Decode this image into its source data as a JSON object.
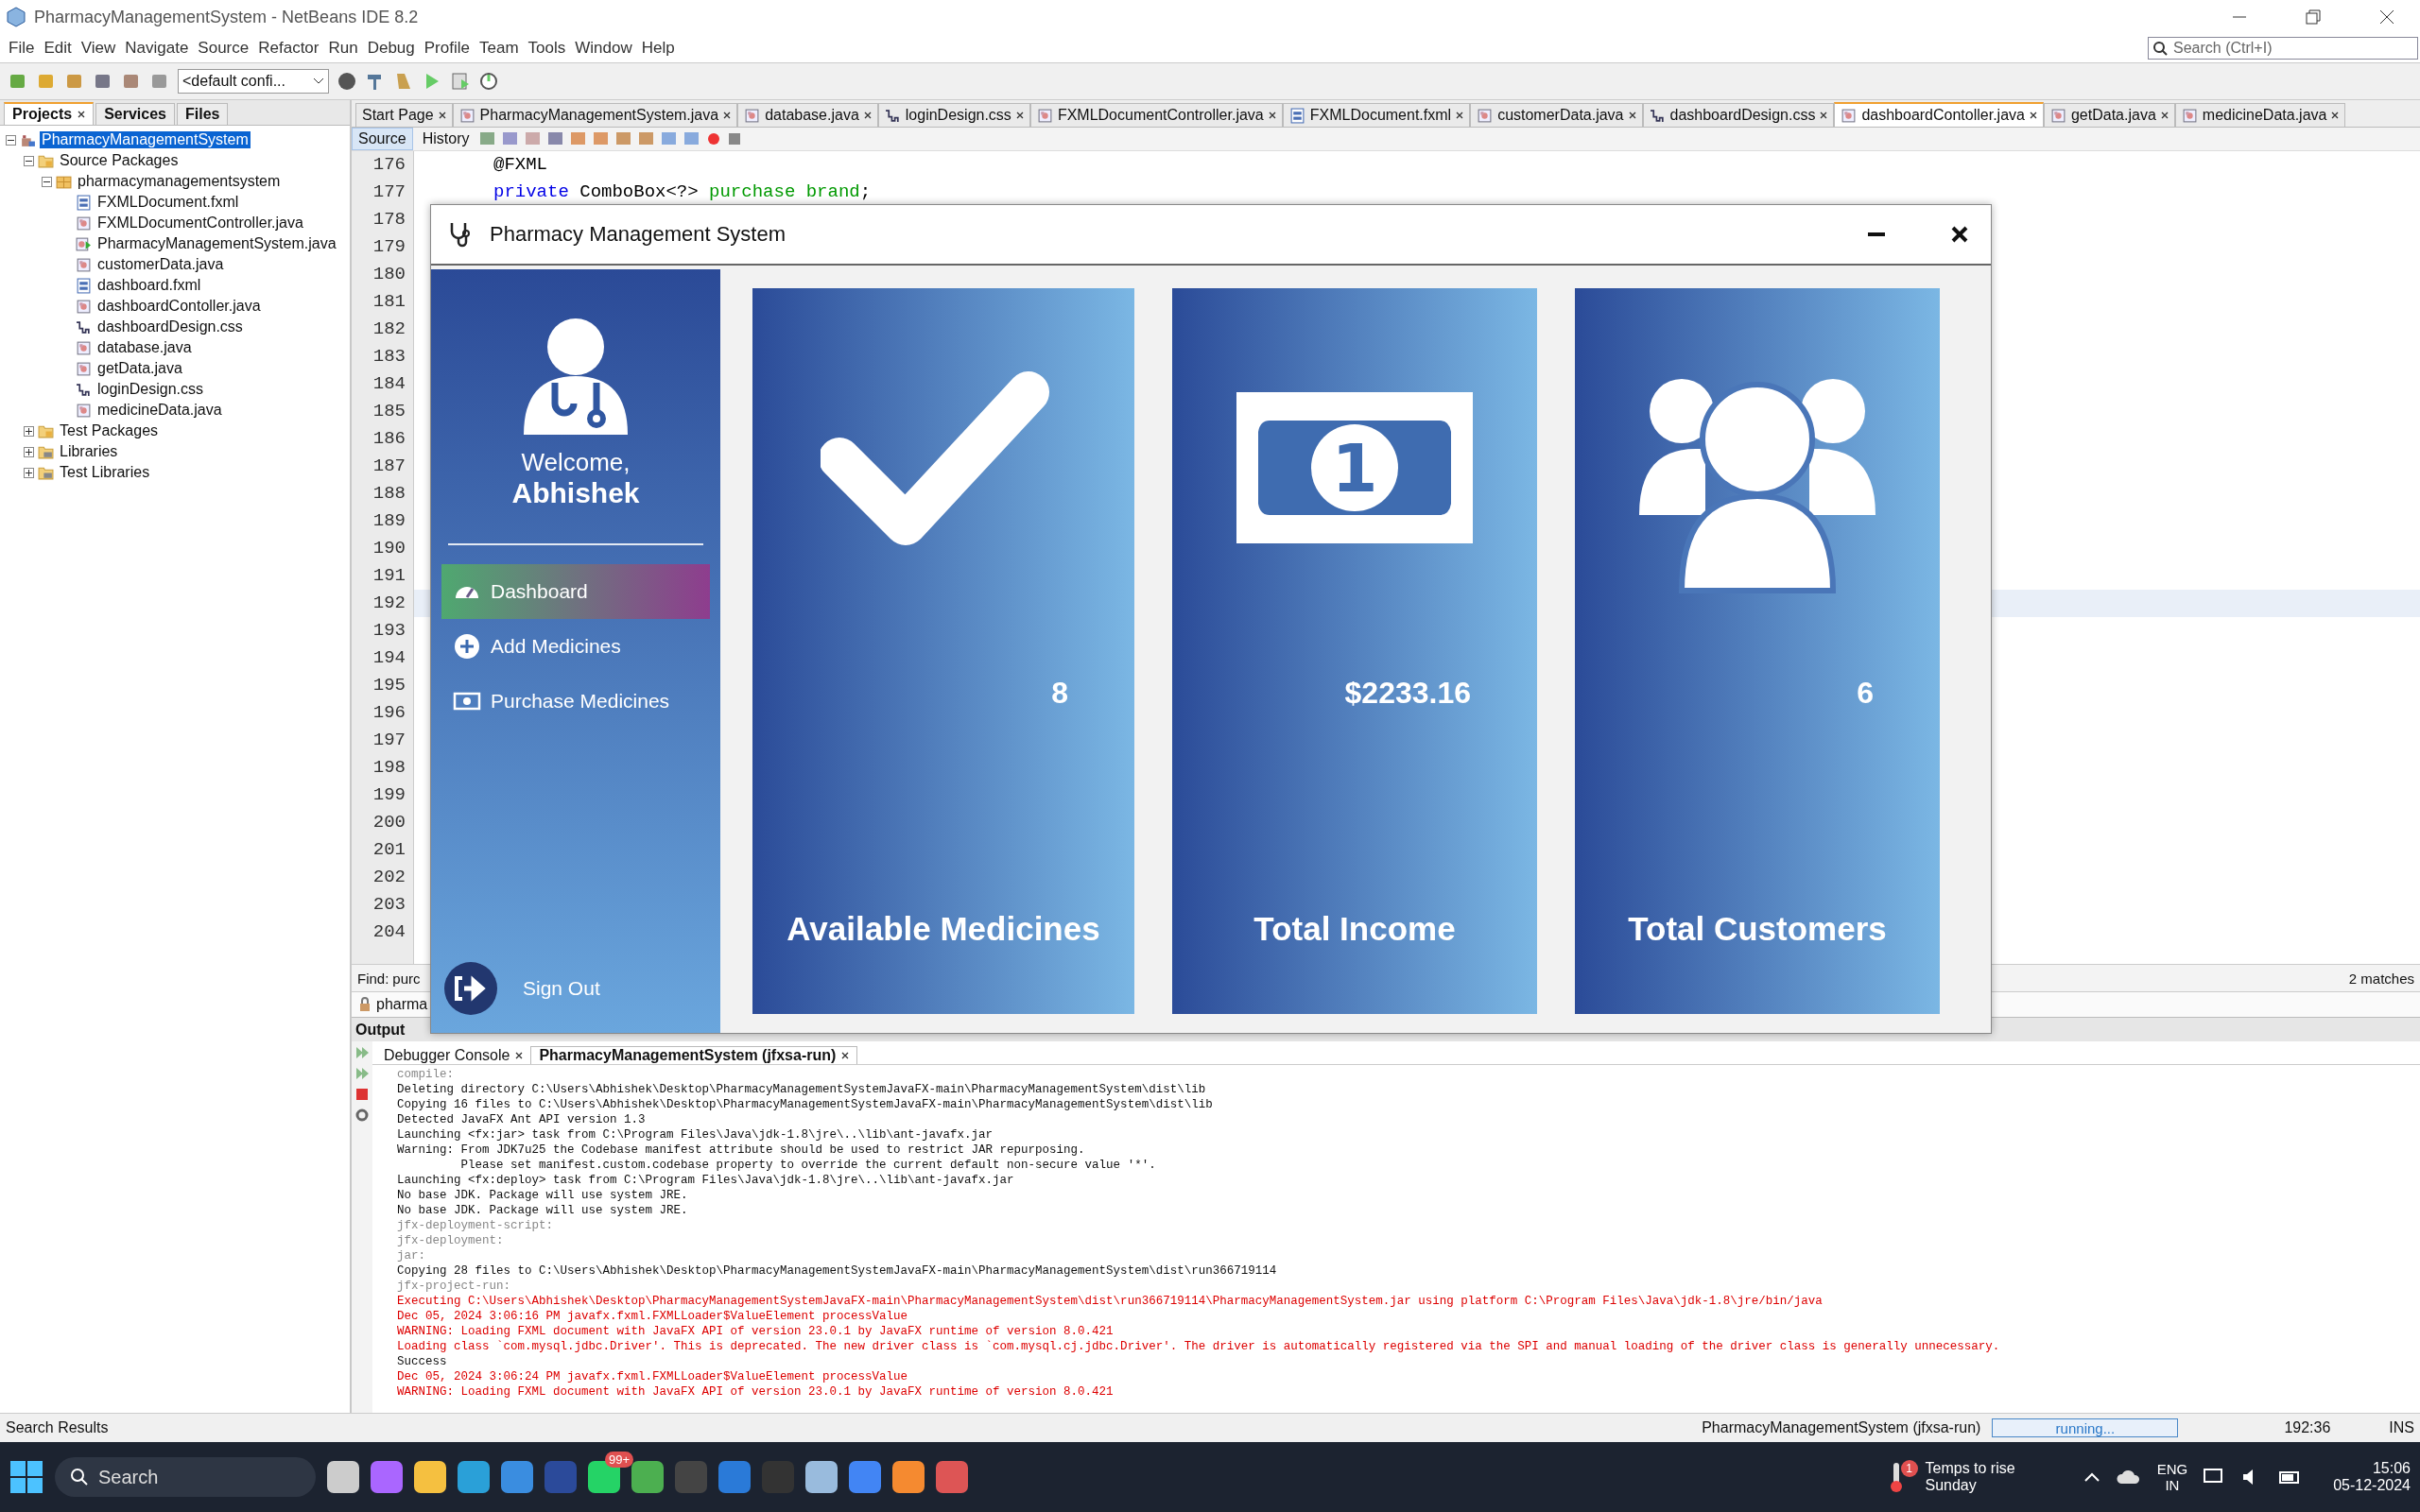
{
  "window": {
    "title": "PharmacyManagementSystem - NetBeans IDE 8.2"
  },
  "menu": [
    "File",
    "Edit",
    "View",
    "Navigate",
    "Source",
    "Refactor",
    "Run",
    "Debug",
    "Profile",
    "Team",
    "Tools",
    "Window",
    "Help"
  ],
  "toolbar": {
    "config": "<default confi..."
  },
  "search": {
    "placeholder": "Search (Ctrl+I)"
  },
  "left_tabs": [
    {
      "label": "Projects",
      "selected": true
    },
    {
      "label": "Services",
      "selected": false
    },
    {
      "label": "Files",
      "selected": false
    }
  ],
  "project_tree": [
    {
      "label": "PharmacyManagementSystem",
      "kind": "project",
      "expanded": true,
      "selected": true,
      "children": [
        {
          "label": "Source Packages",
          "kind": "folder",
          "expanded": true,
          "selected": false,
          "children": [
            {
              "label": "pharmacymanagementsystem",
              "kind": "package",
              "expanded": true,
              "selected": false,
              "children": [
                {
                  "label": "FXMLDocument.fxml",
                  "kind": "fxml",
                  "selected": false
                },
                {
                  "label": "FXMLDocumentController.java",
                  "kind": "java",
                  "selected": false
                },
                {
                  "label": "PharmacyManagementSystem.java",
                  "kind": "main",
                  "selected": false
                },
                {
                  "label": "customerData.java",
                  "kind": "java",
                  "selected": false
                },
                {
                  "label": "dashboard.fxml",
                  "kind": "fxml",
                  "selected": false
                },
                {
                  "label": "dashboardContoller.java",
                  "kind": "java",
                  "selected": false
                },
                {
                  "label": "dashboardDesign.css",
                  "kind": "css",
                  "selected": false
                },
                {
                  "label": "database.java",
                  "kind": "java",
                  "selected": false
                },
                {
                  "label": "getData.java",
                  "kind": "java",
                  "selected": false
                },
                {
                  "label": "loginDesign.css",
                  "kind": "css",
                  "selected": false
                },
                {
                  "label": "medicineData.java",
                  "kind": "java",
                  "selected": false
                }
              ]
            }
          ]
        },
        {
          "label": "Test Packages",
          "kind": "folder",
          "expanded": false,
          "selected": false
        },
        {
          "label": "Libraries",
          "kind": "library",
          "expanded": false,
          "selected": false
        },
        {
          "label": "Test Libraries",
          "kind": "library",
          "expanded": false,
          "selected": false
        }
      ]
    }
  ],
  "editor_tabs": [
    {
      "label": "Start Page",
      "kind": "page",
      "selected": false
    },
    {
      "label": "PharmacyManagementSystem.java",
      "kind": "java",
      "selected": false
    },
    {
      "label": "database.java",
      "kind": "java",
      "selected": false
    },
    {
      "label": "loginDesign.css",
      "kind": "css",
      "selected": false
    },
    {
      "label": "FXMLDocumentController.java",
      "kind": "java",
      "selected": false
    },
    {
      "label": "FXMLDocument.fxml",
      "kind": "fxml",
      "selected": false
    },
    {
      "label": "customerData.java",
      "kind": "java",
      "selected": false
    },
    {
      "label": "dashboardDesign.css",
      "kind": "css",
      "selected": false
    },
    {
      "label": "dashboardContoller.java",
      "kind": "java",
      "selected": true
    },
    {
      "label": "getData.java",
      "kind": "java",
      "selected": false
    },
    {
      "label": "medicineData.java",
      "kind": "java",
      "selected": false
    }
  ],
  "editor_views": [
    {
      "label": "Source",
      "selected": true
    },
    {
      "label": "History",
      "selected": false
    }
  ],
  "code_lines": [
    {
      "number": "176",
      "current": false,
      "tokens": [
        {
          "text": "@FXML",
          "kind": "plain"
        }
      ]
    },
    {
      "number": "177",
      "current": false,
      "tokens": [
        {
          "text": "private",
          "kind": "keyword"
        },
        {
          "text": "ComboBox<?>",
          "kind": "plain"
        },
        {
          "text": "purchase brand",
          "kind": "field"
        },
        {
          "text": ";",
          "kind": "plain"
        }
      ]
    },
    {
      "number": "178",
      "current": false
    },
    {
      "number": "179",
      "current": false
    },
    {
      "number": "180",
      "current": false
    },
    {
      "number": "181",
      "current": false
    },
    {
      "number": "182",
      "current": false
    },
    {
      "number": "183",
      "current": false
    },
    {
      "number": "184",
      "current": false
    },
    {
      "number": "185",
      "current": false
    },
    {
      "number": "186",
      "current": false
    },
    {
      "number": "187",
      "current": false
    },
    {
      "number": "188",
      "current": false
    },
    {
      "number": "189",
      "current": false
    },
    {
      "number": "190",
      "current": false
    },
    {
      "number": "191",
      "current": false
    },
    {
      "number": "192",
      "current": true
    },
    {
      "number": "193",
      "current": false
    },
    {
      "number": "194",
      "current": false
    },
    {
      "number": "195",
      "current": false
    },
    {
      "number": "196",
      "current": false
    },
    {
      "number": "197",
      "current": false
    },
    {
      "number": "198",
      "current": false
    },
    {
      "number": "199",
      "current": false
    },
    {
      "number": "200",
      "current": false
    },
    {
      "number": "201",
      "current": false
    },
    {
      "number": "202",
      "current": false
    },
    {
      "number": "203",
      "current": false
    },
    {
      "number": "204",
      "current": false
    }
  ],
  "find_bar": {
    "label": "Find:",
    "value": "purc",
    "matches": "2 matches"
  },
  "results_tab": "pharma",
  "output": {
    "title": "Output",
    "tabs": [
      {
        "label": "Debugger Console",
        "selected": false
      },
      {
        "label": "PharmacyManagementSystem (jfxsa-run)",
        "selected": true
      }
    ],
    "lines": [
      {
        "text": "compile:",
        "kind": "target"
      },
      {
        "text": "Deleting directory C:\\Users\\Abhishek\\Desktop\\PharmacyManagementSystemJavaFX-main\\PharmacyManagementSystem\\dist\\lib",
        "kind": "info"
      },
      {
        "text": "Copying 16 files to C:\\Users\\Abhishek\\Desktop\\PharmacyManagementSystemJavaFX-main\\PharmacyManagementSystem\\dist\\lib",
        "kind": "info"
      },
      {
        "text": "Detected JavaFX Ant API version 1.3",
        "kind": "info"
      },
      {
        "text": "Launching <fx:jar> task from C:\\Program Files\\Java\\jdk-1.8\\jre\\..\\lib\\ant-javafx.jar",
        "kind": "info"
      },
      {
        "text": "Warning: From JDK7u25 the Codebase manifest attribute should be used to restrict JAR repurposing.",
        "kind": "info"
      },
      {
        "text": "         Please set manifest.custom.codebase property to override the current default non-secure value '*'.",
        "kind": "info"
      },
      {
        "text": "Launching <fx:deploy> task from C:\\Program Files\\Java\\jdk-1.8\\jre\\..\\lib\\ant-javafx.jar",
        "kind": "info"
      },
      {
        "text": "No base JDK. Package will use system JRE.",
        "kind": "info"
      },
      {
        "text": "No base JDK. Package will use system JRE.",
        "kind": "info"
      },
      {
        "text": "jfx-deployment-script:",
        "kind": "target"
      },
      {
        "text": "jfx-deployment:",
        "kind": "target"
      },
      {
        "text": "jar:",
        "kind": "target"
      },
      {
        "text": "Copying 28 files to C:\\Users\\Abhishek\\Desktop\\PharmacyManagementSystemJavaFX-main\\PharmacyManagementSystem\\dist\\run366719114",
        "kind": "info"
      },
      {
        "text": "jfx-project-run:",
        "kind": "target"
      },
      {
        "text": "Executing C:\\Users\\Abhishek\\Desktop\\PharmacyManagementSystemJavaFX-main\\PharmacyManagementSystem\\dist\\run366719114\\PharmacyManagementSystem.jar using platform C:\\Program Files\\Java\\jdk-1.8\\jre/bin/java",
        "kind": "error"
      },
      {
        "text": "Dec 05, 2024 3:06:16 PM javafx.fxml.FXMLLoader$ValueElement processValue",
        "kind": "error"
      },
      {
        "text": "WARNING: Loading FXML document with JavaFX API of version 23.0.1 by JavaFX runtime of version 8.0.421",
        "kind": "error"
      },
      {
        "text": "Loading class `com.mysql.jdbc.Driver'. This is deprecated. The new driver class is `com.mysql.cj.jdbc.Driver'. The driver is automatically registered via the SPI and manual loading of the driver class is generally unnecessary.",
        "kind": "error"
      },
      {
        "text": "Success",
        "kind": "info"
      },
      {
        "text": "Dec 05, 2024 3:06:24 PM javafx.fxml.FXMLLoader$ValueElement processValue",
        "kind": "error"
      },
      {
        "text": "WARNING: Loading FXML document with JavaFX API of version 23.0.1 by JavaFX runtime of version 8.0.421",
        "kind": "error"
      }
    ]
  },
  "status_bar": {
    "left": "Search Results",
    "task": "PharmacyManagementSystem (jfxsa-run)",
    "progress": "running...",
    "position": "192:36",
    "mode": "INS"
  },
  "app": {
    "title": "Pharmacy Management System",
    "greeting": "Welcome,",
    "user": "Abhishek",
    "nav": [
      {
        "label": "Dashboard",
        "kind": "dashboard",
        "selected": true
      },
      {
        "label": "Add Medicines",
        "kind": "add",
        "selected": false
      },
      {
        "label": "Purchase Medicines",
        "kind": "purchase",
        "selected": false
      }
    ],
    "sign_out": "Sign Out",
    "cards": [
      {
        "kind": "check",
        "value": "8",
        "title": "Available Medicines"
      },
      {
        "kind": "money",
        "icon_label": "1",
        "value": "$2233.16",
        "title": "Total Income"
      },
      {
        "kind": "users",
        "value": "6",
        "title": "Total Customers"
      }
    ]
  },
  "taskbar": {
    "search": "Search",
    "whatsapp_badge": "99+",
    "weather_badge": "1",
    "weather_title": "Temps to rise",
    "weather_sub": "Sunday",
    "lang": "ENG",
    "region": "IN",
    "time": "15:06",
    "date": "05-12-2024"
  }
}
